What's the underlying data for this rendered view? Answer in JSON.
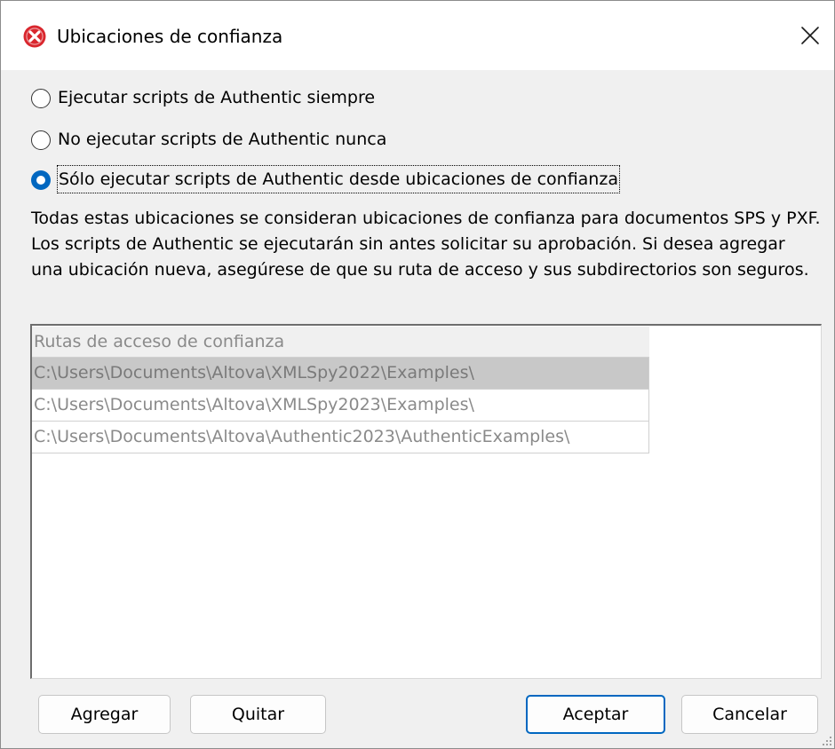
{
  "window": {
    "title": "Ubicaciones de confianza",
    "icon": "altova-x-icon",
    "close_glyph": "✕"
  },
  "options": [
    {
      "label": "Ejecutar scripts de Authentic siempre",
      "checked": false
    },
    {
      "label": "No ejecutar scripts de Authentic nunca",
      "checked": false
    },
    {
      "label": "Sólo ejecutar scripts de Authentic desde ubicaciones de confianza",
      "checked": true
    }
  ],
  "description": "Todas estas ubicaciones se consideran ubicaciones de confianza para documentos SPS y PXF. Los scripts de Authentic se ejecutarán sin antes solicitar su aprobación. Si desea agregar una ubicación nueva, asegúrese de que su ruta de acceso y sus subdirectorios son seguros.",
  "table": {
    "header": "Rutas de acceso de confianza",
    "rows": [
      "C:\\Users\\Documents\\Altova\\XMLSpy2022\\Examples\\",
      "C:\\Users\\Documents\\Altova\\XMLSpy2023\\Examples\\",
      "C:\\Users\\Documents\\Altova\\Authentic2023\\AuthenticExamples\\"
    ],
    "selected_row": 0
  },
  "buttons": {
    "add": "Agregar",
    "remove": "Quitar",
    "ok": "Aceptar",
    "cancel": "Cancelar"
  },
  "colors": {
    "accent": "#0067c0",
    "icon_red": "#d9272e",
    "selection": "#c8c8c8"
  }
}
